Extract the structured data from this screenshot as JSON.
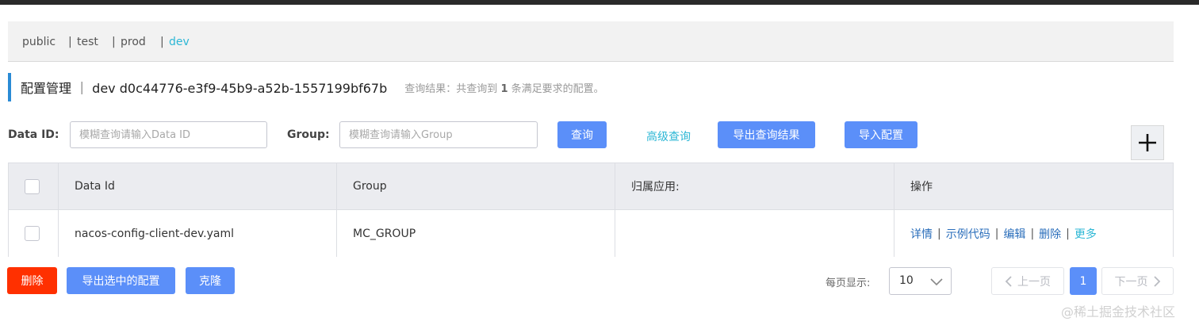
{
  "namespaces": [
    {
      "label": "public",
      "active": false
    },
    {
      "label": "test",
      "active": false
    },
    {
      "label": "prod",
      "active": false
    },
    {
      "label": "dev",
      "active": true
    }
  ],
  "namespace_separator": "|",
  "header": {
    "title": "配置管理 ｜ dev  d0c44776-e3f9-45b9-a52b-1557199bf67b",
    "result_prefix": "查询结果：共查询到",
    "result_count": "1",
    "result_suffix": "条满足要求的配置。"
  },
  "search": {
    "data_id_label": "Data ID:",
    "data_id_placeholder": "模糊查询请输入Data ID",
    "data_id_value": "",
    "group_label": "Group:",
    "group_placeholder": "模糊查询请输入Group",
    "group_value": "",
    "query_button": "查询",
    "advanced_link": "高级查询",
    "export_button": "导出查询结果",
    "import_button": "导入配置"
  },
  "table": {
    "columns": [
      "",
      "Data Id",
      "Group",
      "归属应用:",
      "操作"
    ],
    "rows": [
      {
        "data_id": "nacos-config-client-dev.yaml",
        "group": "MC_GROUP",
        "app": "",
        "ops": [
          "详情",
          "示例代码",
          "编辑",
          "删除",
          "更多"
        ]
      }
    ]
  },
  "footer": {
    "delete_button": "删除",
    "export_selected_button": "导出选中的配置",
    "clone_button": "克隆",
    "page_size_label": "每页显示:",
    "page_size_value": "10",
    "prev_label": "上一页",
    "current_page": "1",
    "next_label": "下一页"
  },
  "watermark": "@稀土掘金技术社区",
  "colors": {
    "primary": "#5b8ff9",
    "link": "#2db7d5",
    "danger": "#ff3000",
    "accent_bar": "#2a8bd5"
  }
}
